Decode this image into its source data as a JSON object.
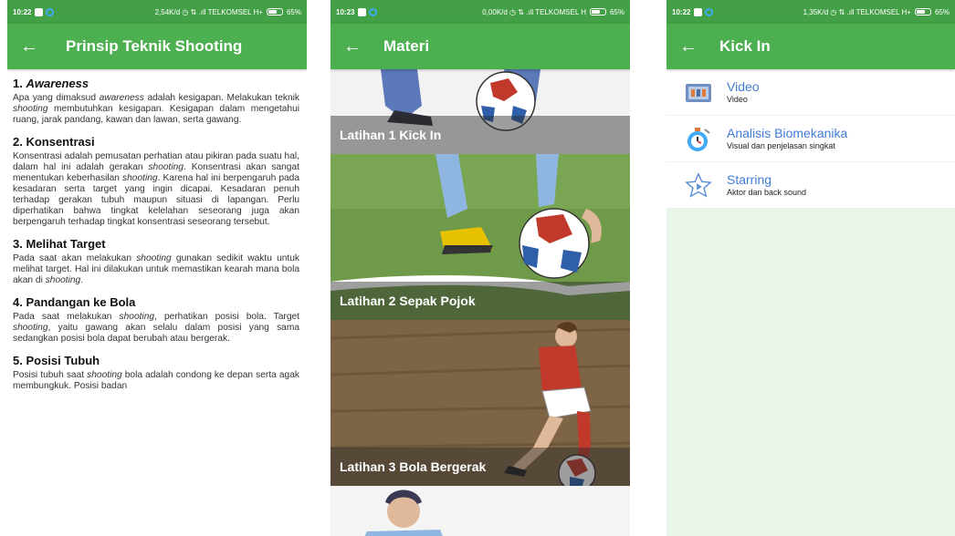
{
  "screens": [
    {
      "status": {
        "time": "10:22",
        "right": "2,54K/d ◷ ⇅ .ıll TELKOMSEL H+",
        "battery": "65%",
        "battery_level": 0.65
      },
      "appbar": {
        "back_icon": "arrow-left-icon",
        "title": "Prinsip Teknik Shooting"
      },
      "sections": [
        {
          "heading": "1. Awareness",
          "body": "Apa yang dimaksud awareness adalah kesigapan. Melakukan teknik shooting membutuhkan kesigapan. Kesigapan dalam mengetahui ruang, jarak pandang, kawan dan lawan, serta gawang."
        },
        {
          "heading": "2. Konsentrasi",
          "body": "Konsentrasi adalah pemusatan perhatian atau pikiran pada suatu hal, dalam hal ini adalah gerakan shooting. Konsentrasi akan sangat menentukan keberhasilan shooting. Karena hal ini berpengaruh pada kesadaran serta target yang ingin dicapai. Kesadaran penuh terhadap gerakan tubuh maupun situasi di lapangan. Perlu diperhatikan bahwa tingkat kelelahan seseorang juga akan berpengaruh terhadap tingkat konsentrasi seseorang tersebut."
        },
        {
          "heading": "3. Melihat Target",
          "body": "Pada saat akan melakukan shooting gunakan sedikit waktu untuk melihat target. Hal ini dilakukan untuk memastikan kearah mana bola akan di shooting."
        },
        {
          "heading": "4. Pandangan ke Bola",
          "body": "Pada saat melakukan shooting, perhatikan posisi bola. Target shooting, yaitu gawang akan selalu dalam posisi yang sama sedangkan posisi bola dapat berubah atau bergerak."
        },
        {
          "heading": "5. Posisi Tubuh",
          "body": "Posisi tubuh saat shooting bola adalah condong ke depan serta agak membungkuk. Posisi badan"
        }
      ]
    },
    {
      "status": {
        "time": "10:23",
        "right": "0,00K/d ◷ ⇅ .ıll TELKOMSEL H",
        "battery": "65%",
        "battery_level": 0.65
      },
      "appbar": {
        "back_icon": "arrow-left-icon",
        "title": "Materi"
      },
      "cards": [
        {
          "label": "Latihan 1  Kick In"
        },
        {
          "label": "Latihan 2  Sepak Pojok"
        },
        {
          "label": "Latihan 3  Bola Bergerak"
        }
      ]
    },
    {
      "status": {
        "time": "10:22",
        "right": "1,35K/d ◷ ⇅ .ıll TELKOMSEL H+",
        "battery": "65%",
        "battery_level": 0.65
      },
      "appbar": {
        "back_icon": "arrow-left-icon",
        "title": "Kick In"
      },
      "items": [
        {
          "title": "Video",
          "subtitle": "Video",
          "icon": "video-file-icon"
        },
        {
          "title": "Analisis Biomekanika",
          "subtitle": "Visual dan penjelasan singkat",
          "icon": "stopwatch-icon"
        },
        {
          "title": "Starring",
          "subtitle": "Aktor dan back sound",
          "icon": "star-play-icon"
        }
      ]
    }
  ],
  "colors": {
    "primary": "#4caf50",
    "status_bar": "#43a047",
    "link": "#3f7cd6",
    "screen_bg": "#e9f5e9"
  }
}
